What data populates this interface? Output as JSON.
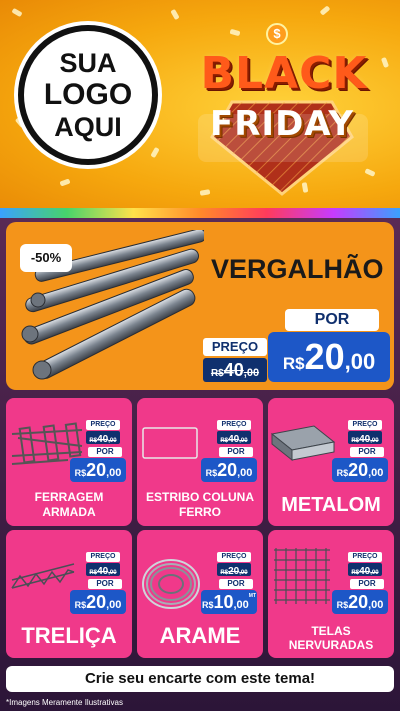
{
  "logo": {
    "line1": "SUA",
    "line2": "LOGO",
    "line3": "AQUI"
  },
  "banner": {
    "badge": "$",
    "line1": "BLACK",
    "line2": "FRIDAY"
  },
  "hero": {
    "discount": "-50%",
    "title": "VERGALHÃO",
    "preco_label": "PREÇO",
    "old_currency": "R$",
    "old_int": "40",
    "old_cents": ",00",
    "por_label": "POR",
    "new_currency": "R$",
    "new_int": "20",
    "new_cents": ",00"
  },
  "products": [
    {
      "title_1": "FERRAGEM",
      "title_2": "ARMADA",
      "preco_label": "PREÇO",
      "old_currency": "R$",
      "old_int": "40",
      "old_cents": ",00",
      "por_label": "POR",
      "new_currency": "R$",
      "new_int": "20",
      "new_cents": ",00"
    },
    {
      "title_1": "ESTRIBO COLUNA",
      "title_2": "FERRO",
      "preco_label": "PREÇO",
      "old_currency": "R$",
      "old_int": "40",
      "old_cents": ",00",
      "por_label": "POR",
      "new_currency": "R$",
      "new_int": "20",
      "new_cents": ",00"
    },
    {
      "title_1": "METALOM",
      "preco_label": "PREÇO",
      "old_currency": "R$",
      "old_int": "40",
      "old_cents": ",00",
      "por_label": "POR",
      "new_currency": "R$",
      "new_int": "20",
      "new_cents": ",00"
    },
    {
      "title_1": "TRELIÇA",
      "preco_label": "PREÇO",
      "old_currency": "R$",
      "old_int": "40",
      "old_cents": ",00",
      "por_label": "POR",
      "new_currency": "R$",
      "new_int": "20",
      "new_cents": ",00"
    },
    {
      "title_1": "ARAME",
      "preco_label": "PREÇO",
      "old_currency": "R$",
      "old_int": "20",
      "old_cents": ",00",
      "por_label": "POR",
      "new_currency": "R$",
      "new_int": "10",
      "new_cents": ",00",
      "unit": "MT"
    },
    {
      "title_1": "TELAS",
      "title_2": "NERVURADAS",
      "preco_label": "PREÇO",
      "old_currency": "R$",
      "old_int": "40",
      "old_cents": ",00",
      "por_label": "POR",
      "new_currency": "R$",
      "new_int": "20",
      "new_cents": ",00"
    }
  ],
  "cta": "Crie seu encarte com este tema!",
  "disclaimer": "*Imagens Meramente Ilustrativas",
  "colors": {
    "header": "#f6a80e",
    "hero": "#f4941a",
    "card": "#f0398a",
    "price_blue": "#1d57c7",
    "navy": "#10306e"
  },
  "icons": [
    "rebar-image",
    "rebar-cage-image",
    "stirrup-image",
    "metal-profile-image",
    "truss-image",
    "wire-coil-image",
    "mesh-image"
  ]
}
